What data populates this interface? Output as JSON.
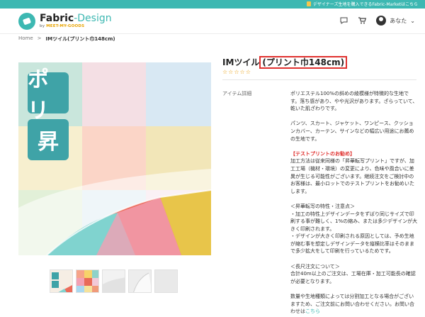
{
  "topbar": {
    "message": "デザイナーズ生地を購入できるFabric-Marketはこちら"
  },
  "header": {
    "logo_title_a": "Fabric",
    "logo_title_b": "-Design",
    "logo_sub_a": "by",
    "logo_sub_b": "MEET-MY-GOODS",
    "user_label": "あなた",
    "chevron": "⌄"
  },
  "breadcrumb": {
    "home": "Home",
    "sep": ">",
    "current": "IMツイル(プリント巾148cm)"
  },
  "product": {
    "title_main": "IMツイル",
    "title_highlight": "(プリント巾148cm)",
    "stars": "☆☆☆☆☆",
    "detail_label": "アイテム詳細",
    "badges": [
      "ポリ",
      "昇"
    ],
    "desc_p1": "ポリエステル100%の斜めの綾模様が特徴的な生地です。落ち感があり、やや光沢があります。ざらっていて、乾いた肌ざわりです。",
    "desc_p2": "パンツ、スカート、ジャケット、ワンピース、クッションカバー、カーテン、サインなどの幅広い用途にお薦めの生地です。",
    "desc_red": "【テストプリントのお勧め】",
    "desc_p3": "加工方法は従来同様の「昇華転写プリント」ですが、加工工場（機材・環境）の変更により、色味や風合いに差異が生じる可能性がございます。継続注文をご検討中のお客様は、最小ロットでのテストプリントをお勧めいたします。",
    "desc_p4a": "＜昇華転写の特性・注意点＞",
    "desc_p4b": "・加工の特性上デザインデータをずばり同じサイズで印刷する事が難しく、1%の縮み、または多少デザインが大きく印刷されます。",
    "desc_p4c": "・デザインが大きく印刷される原因としては、予め生地が縮む事を想定しデザインデータを縦横比率はそのままで多少拡大をして印刷を行っているためです。",
    "desc_p5a": "＜長尺注文について＞",
    "desc_p5b": "合計40m以上のご注文は、工場在庫・加工可能長の確認が必要となります。",
    "desc_p6": "数量や生地種類によっては分割加工となる場合がございますため、ご注文前にお問い合わせください。お問い合わせは",
    "desc_link": "こちら"
  },
  "colors": {
    "accent": "#3db8b2",
    "highlight_border": "#e0312f",
    "badge": "#3fa3a7"
  }
}
